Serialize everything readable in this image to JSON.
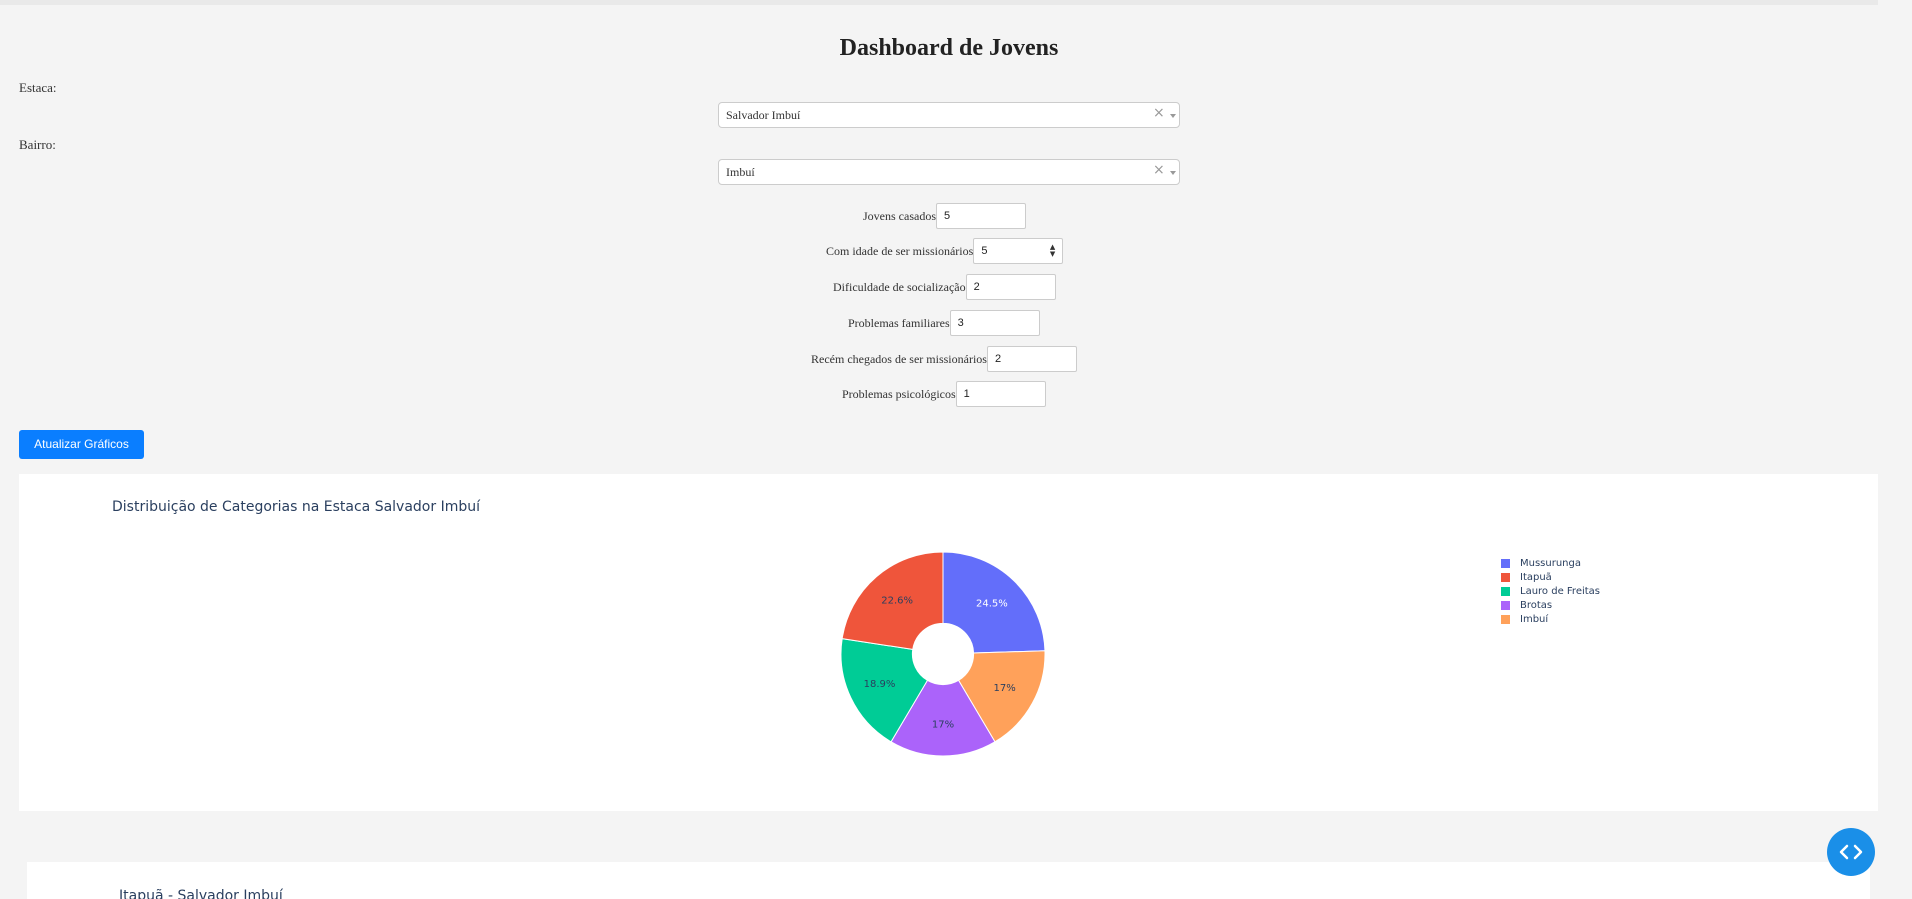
{
  "title": "Dashboard de Jovens",
  "filters": {
    "estaca_label": "Estaca:",
    "estaca_value": "Salvador Imbuí",
    "bairro_label": "Bairro:",
    "bairro_value": "Imbuí",
    "clear_glyph": "×"
  },
  "fields": [
    {
      "label": "Jovens casados",
      "value": "5"
    },
    {
      "label": "Com idade de ser missionários",
      "value": "5"
    },
    {
      "label": "Dificuldade de socialização",
      "value": "2"
    },
    {
      "label": "Problemas familiares",
      "value": "3"
    },
    {
      "label": "Recém chegados de ser missionários",
      "value": "2"
    },
    {
      "label": "Problemas psicológicos",
      "value": "1"
    }
  ],
  "update_button": "Atualizar Gráficos",
  "chart1": {
    "title": "Distribuição de Categorias na Estaca Salvador Imbuí"
  },
  "chart_data": {
    "type": "pie",
    "hole": 0.3,
    "categories": [
      "Mussurunga",
      "Imbuí",
      "Brotas",
      "Lauro de Freitas",
      "Itapuã"
    ],
    "values": [
      24.5,
      17,
      17,
      18.9,
      22.6
    ],
    "labels": [
      "24.5%",
      "17%",
      "17%",
      "18.9%",
      "22.6%"
    ],
    "colors": [
      "#636efa",
      "#ffa15a",
      "#ab63fa",
      "#00cc96",
      "#ef553b"
    ],
    "legend": [
      "Mussurunga",
      "Itapuã",
      "Lauro de Freitas",
      "Brotas",
      "Imbuí"
    ],
    "legend_colors": [
      "#636efa",
      "#ef553b",
      "#00cc96",
      "#ab63fa",
      "#ffa15a"
    ],
    "legend_position": "right"
  },
  "chart2": {
    "title": "Itapuã - Salvador Imbuí"
  }
}
